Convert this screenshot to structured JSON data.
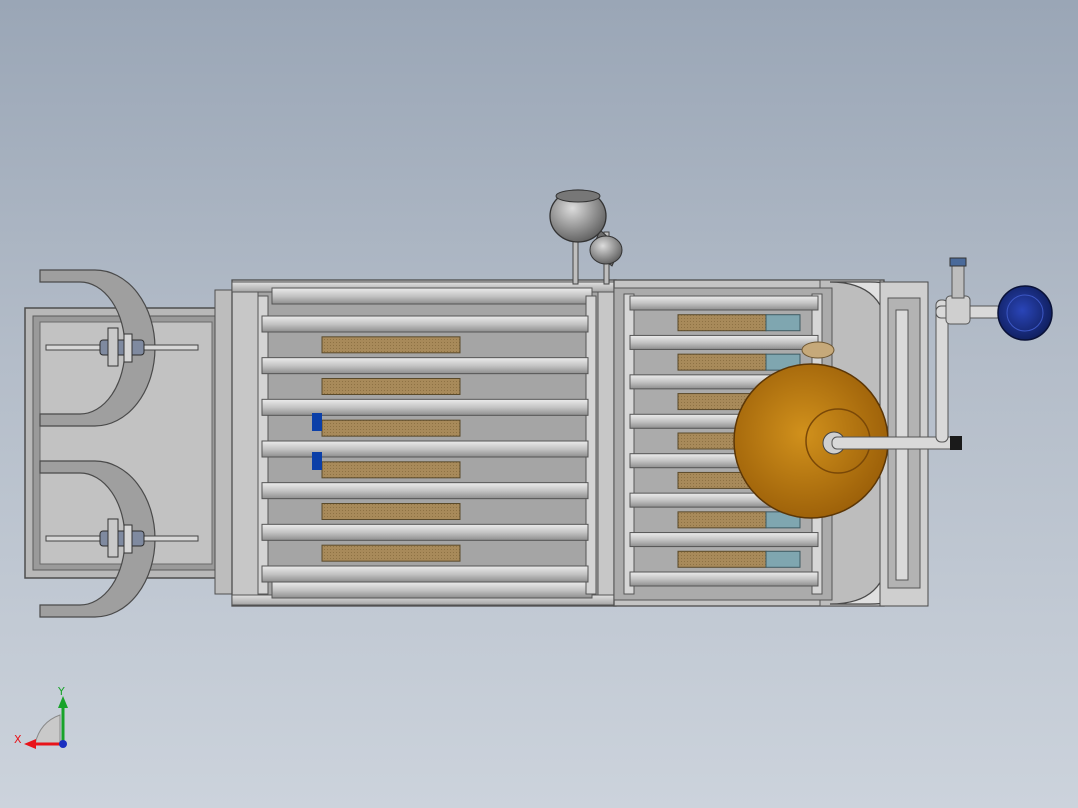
{
  "triad": {
    "x_label": "X",
    "y_label": "Y",
    "x_color": "#e8141a",
    "y_color": "#18a32a",
    "z_color": "#1a2fc0"
  },
  "palette": {
    "background_top": "#9aa6b6",
    "background_bottom": "#ccd3dc",
    "frame_gray": "#c9c9c9",
    "frame_dark": "#6e6e6e",
    "wood_block": "#a98b5c",
    "accent_blue": "#0b3fa8",
    "disc_orange": "#b8730c",
    "motor_blue": "#1c2f86",
    "teal_block": "#7fa6b0"
  },
  "model": {
    "left_rack_slats": 7,
    "left_rack_blocks": 6,
    "right_rack_slats": 8,
    "right_rack_blocks": 7
  }
}
